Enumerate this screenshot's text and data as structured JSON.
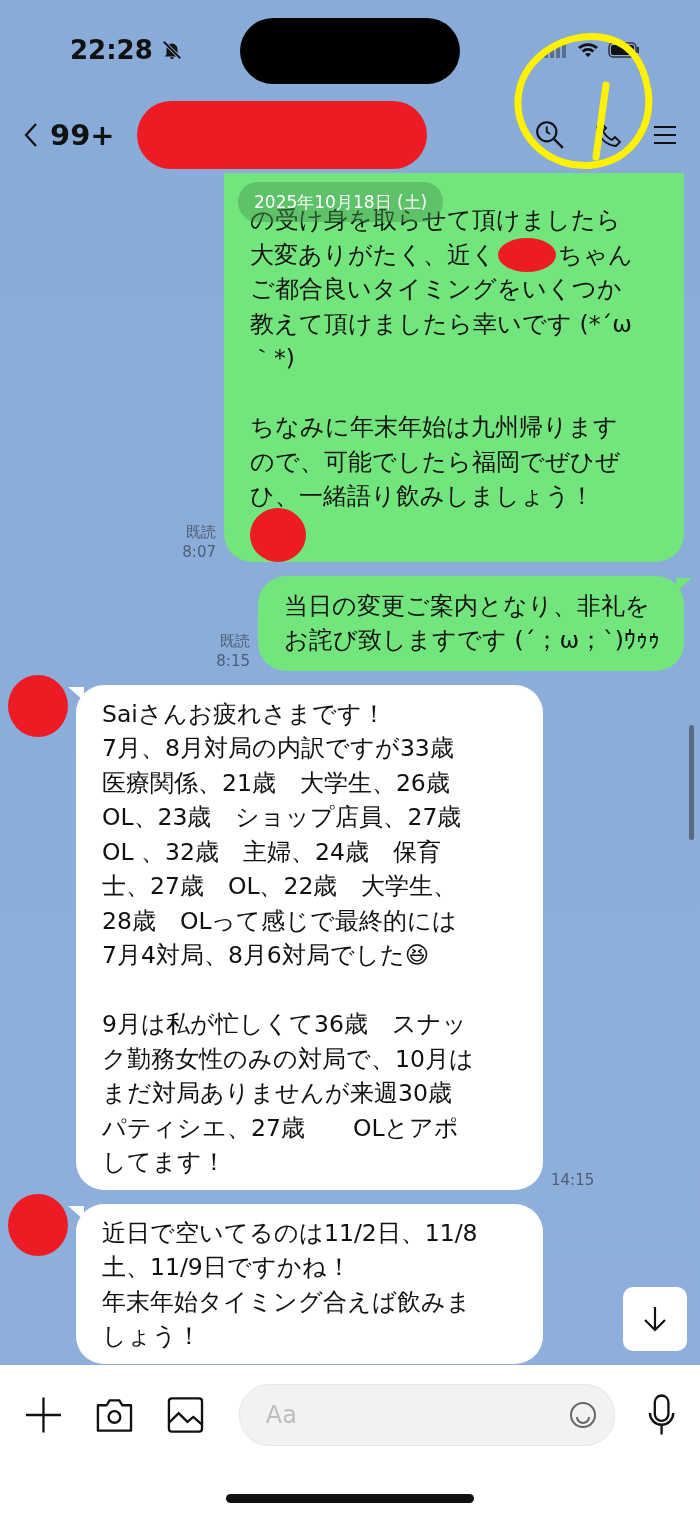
{
  "status_bar": {
    "time": "22:28"
  },
  "header": {
    "back_count": "99+"
  },
  "date_label": "2025年10月18日 (土)",
  "messages": [
    {
      "kind": "sent",
      "tail": false,
      "read": "既読",
      "time": "8:07",
      "lines": [
        {
          "kind": "text",
          "text": "の受け身を取らせて頂けましたら"
        },
        {
          "kind": "redacted",
          "before": "大変ありがたく、近く",
          "after": "ちゃん"
        },
        {
          "kind": "text",
          "text": "ご都合良いタイミングをいくつか"
        },
        {
          "kind": "text",
          "text": "教えて頂けましたら幸いです (*´ω"
        },
        {
          "kind": "text",
          "text": "｀*)"
        },
        {
          "kind": "gap"
        },
        {
          "kind": "text",
          "text": "ちなみに年末年始は九州帰ります"
        },
        {
          "kind": "text",
          "text": "ので、可能でしたら福岡でぜひぜ"
        },
        {
          "kind": "text",
          "text": "ひ、一緒語り飲みしましょう！"
        },
        {
          "kind": "redaction"
        }
      ]
    },
    {
      "kind": "sent",
      "tail": true,
      "read": "既読",
      "time": "8:15",
      "lines": [
        {
          "kind": "text",
          "text": "当日の変更ご案内となり、非礼を"
        },
        {
          "kind": "text",
          "text": "お詫び致しますです (´；ω；`)ｳｩｩ"
        }
      ]
    },
    {
      "kind": "received",
      "tail": true,
      "time": "14:15",
      "lines": [
        {
          "kind": "text",
          "text": "Saiさんお疲れさまです！"
        },
        {
          "kind": "text",
          "text": "7月、8月対局の内訳ですが33歳"
        },
        {
          "kind": "text",
          "text": "医療関係、21歳　大学生、26歳"
        },
        {
          "kind": "text",
          "text": "OL、23歳　ショップ店員、27歳"
        },
        {
          "kind": "text",
          "text": "OL 、32歳　主婦、24歳　保育"
        },
        {
          "kind": "text",
          "text": "士、27歳　OL、22歳　大学生、"
        },
        {
          "kind": "text",
          "text": "28歳　OLって感じで最終的には"
        },
        {
          "kind": "text",
          "text": "7月4対局、8月6対局でした😆"
        },
        {
          "kind": "gap"
        },
        {
          "kind": "text",
          "text": "9月は私が忙しくて36歳　スナッ"
        },
        {
          "kind": "text",
          "text": "ク勤務女性のみの対局で、10月は"
        },
        {
          "kind": "text",
          "text": "まだ対局ありませんが来週30歳"
        },
        {
          "kind": "text",
          "text": "パティシエ、27歳　　OLとアポ"
        },
        {
          "kind": "text",
          "text": "してます！"
        }
      ]
    },
    {
      "kind": "received",
      "tail": true,
      "lines": [
        {
          "kind": "text",
          "text": "近日で空いてるのは11/2日、11/8"
        },
        {
          "kind": "text",
          "text": "土、11/9日ですかね！"
        },
        {
          "kind": "text",
          "text": "年末年始タイミング合えば飲みま"
        },
        {
          "kind": "text",
          "text": "しょう！"
        }
      ]
    }
  ],
  "input": {
    "placeholder": "Aa"
  }
}
